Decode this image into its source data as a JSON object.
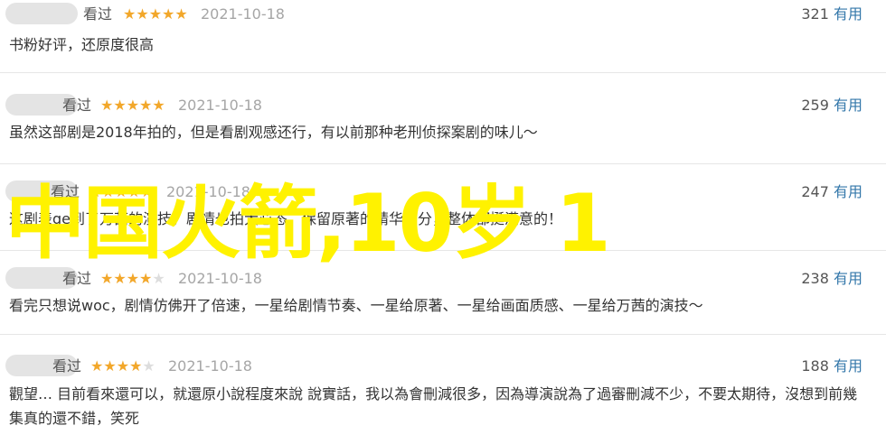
{
  "reviews": [
    {
      "status": "看过",
      "rating_stars": 5,
      "date": "2021-10-18",
      "votes": "321",
      "useful_label": "有用",
      "text": "书粉好评，还原度很高"
    },
    {
      "status": "看过",
      "rating_stars": 5,
      "date": "2021-10-18",
      "votes": "259",
      "useful_label": "有用",
      "text": "虽然这部剧是2018年拍的，但是看剧观感还行，有以前那种老刑侦探案剧的味儿～"
    },
    {
      "status": "看过",
      "rating_stars": 5,
      "date": "2021-10-18",
      "votes": "247",
      "useful_label": "有用",
      "text": "这剧表ge到了万茜的演技，剧情也拍大心态，保留原著的精华部分，整体都挺满意的！"
    },
    {
      "status": "看过",
      "rating_stars": 4,
      "date": "2021-10-18",
      "votes": "238",
      "useful_label": "有用",
      "text": "看完只想说woc，剧情仿佛开了倍速，一星给剧情节奏、一星给原著、一星给画面质感、一星给万茜的演技～"
    },
    {
      "status": "看过",
      "rating_stars": 4,
      "date": "2021-10-18",
      "votes": "188",
      "useful_label": "有用",
      "text": "觀望… 目前看來還可以，就還原小說程度來說 說實話，我以為會刪減很多，因為導演說為了過審刪減不少，不要太期待，沒想到前幾集真的還不錯，笑死"
    }
  ],
  "overlay_text": "中国火箭,10岁 1",
  "colors": {
    "star": "#f2a72a",
    "star_empty": "#dddddd",
    "link": "#3377aa",
    "overlay": "#fff200"
  }
}
